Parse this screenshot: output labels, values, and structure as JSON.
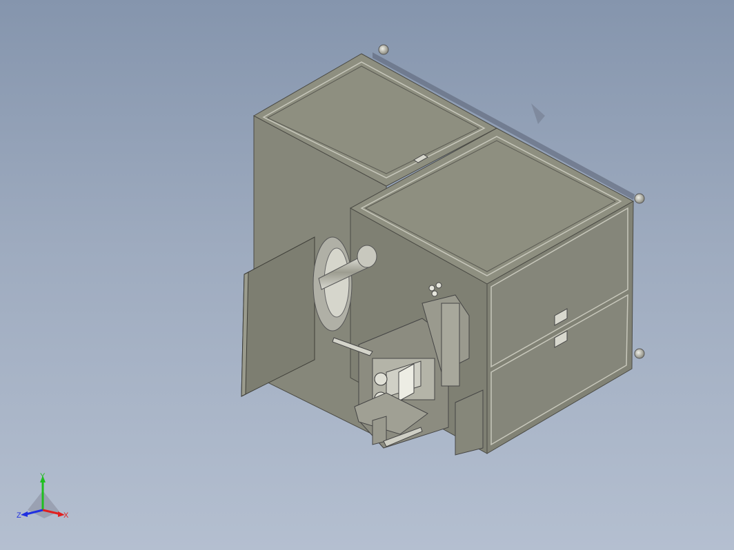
{
  "view": {
    "background_top": "#8595ad",
    "background_bottom": "#b4bfd0",
    "model_color": "#8a8b7c"
  },
  "triad": {
    "y_label": "Y",
    "x_label": "X",
    "z_label": "Z",
    "y_color": "#1fbf1f",
    "x_color": "#e02020",
    "z_color": "#2030e0"
  }
}
